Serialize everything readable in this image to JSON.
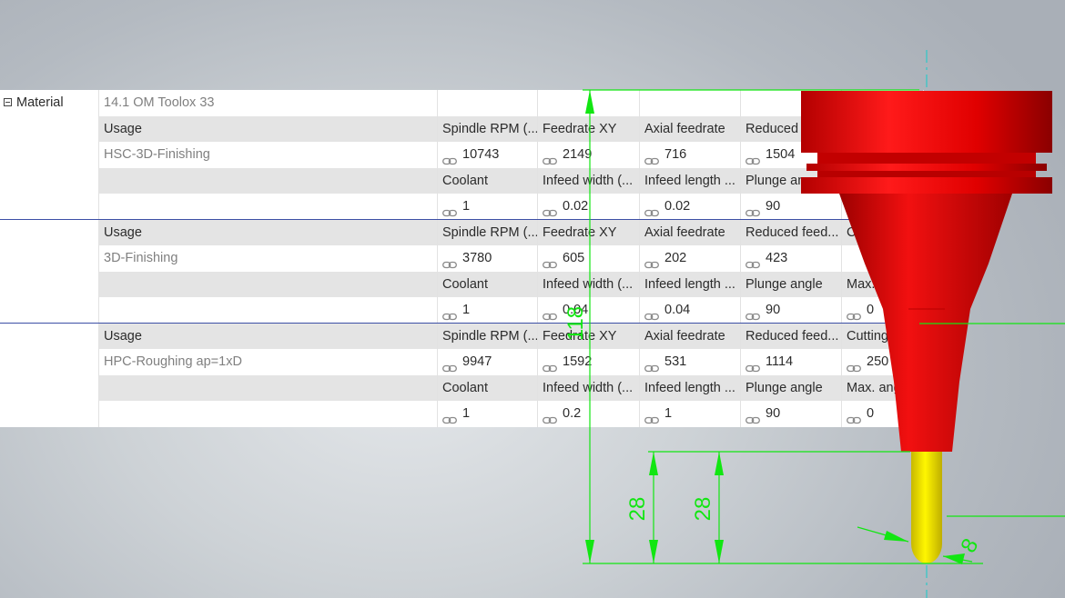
{
  "material": {
    "label": "Material",
    "value": "14.1 OM Toolox 33"
  },
  "groups": [
    {
      "usage_label": "Usage",
      "usage_value": "HSC-3D-Finishing",
      "headers1": [
        "Spindle RPM (...",
        "Feedrate XY",
        "Axial feedrate",
        "Reduced",
        ""
      ],
      "values1": [
        "10743",
        "2149",
        "716",
        "1504",
        ""
      ],
      "headers2": [
        "Coolant",
        "Infeed width (...",
        "Infeed length ...",
        "Plunge an",
        ""
      ],
      "values2": [
        "1",
        "0.02",
        "0.02",
        "90",
        ""
      ]
    },
    {
      "usage_label": "Usage",
      "usage_value": "3D-Finishing",
      "headers1": [
        "Spindle RPM (...",
        "Feedrate XY",
        "Axial feedrate",
        "Reduced feed...",
        "C"
      ],
      "values1": [
        "3780",
        "605",
        "202",
        "423",
        ""
      ],
      "headers2": [
        "Coolant",
        "Infeed width (...",
        "Infeed length ...",
        "Plunge angle",
        "Max."
      ],
      "values2": [
        "1",
        "0.04",
        "0.04",
        "90",
        "0"
      ]
    },
    {
      "usage_label": "Usage",
      "usage_value": "HPC-Roughing ap=1xD",
      "headers1": [
        "Spindle RPM (...",
        "Feedrate XY",
        "Axial feedrate",
        "Reduced feed...",
        "Cutting"
      ],
      "values1": [
        "9947",
        "1592",
        "531",
        "1114",
        "250"
      ],
      "headers2": [
        "Coolant",
        "Infeed width (...",
        "Infeed length ...",
        "Plunge angle",
        "Max. ang"
      ],
      "values2": [
        "1",
        "0.2",
        "1",
        "90",
        "0"
      ]
    }
  ],
  "dimensions": {
    "overall_length": "118",
    "length_a": "28",
    "length_b": "28",
    "diameter": "8"
  },
  "colors": {
    "dimension_line": "#12e612",
    "holder_red": "#e60f0f",
    "shank_yellow": "#f3e600",
    "axis_cyan": "#2ec8c8",
    "group_separator": "#3c4fa6"
  },
  "icons": {
    "expander": "minus-box-icon",
    "value_link": "link-icon"
  }
}
